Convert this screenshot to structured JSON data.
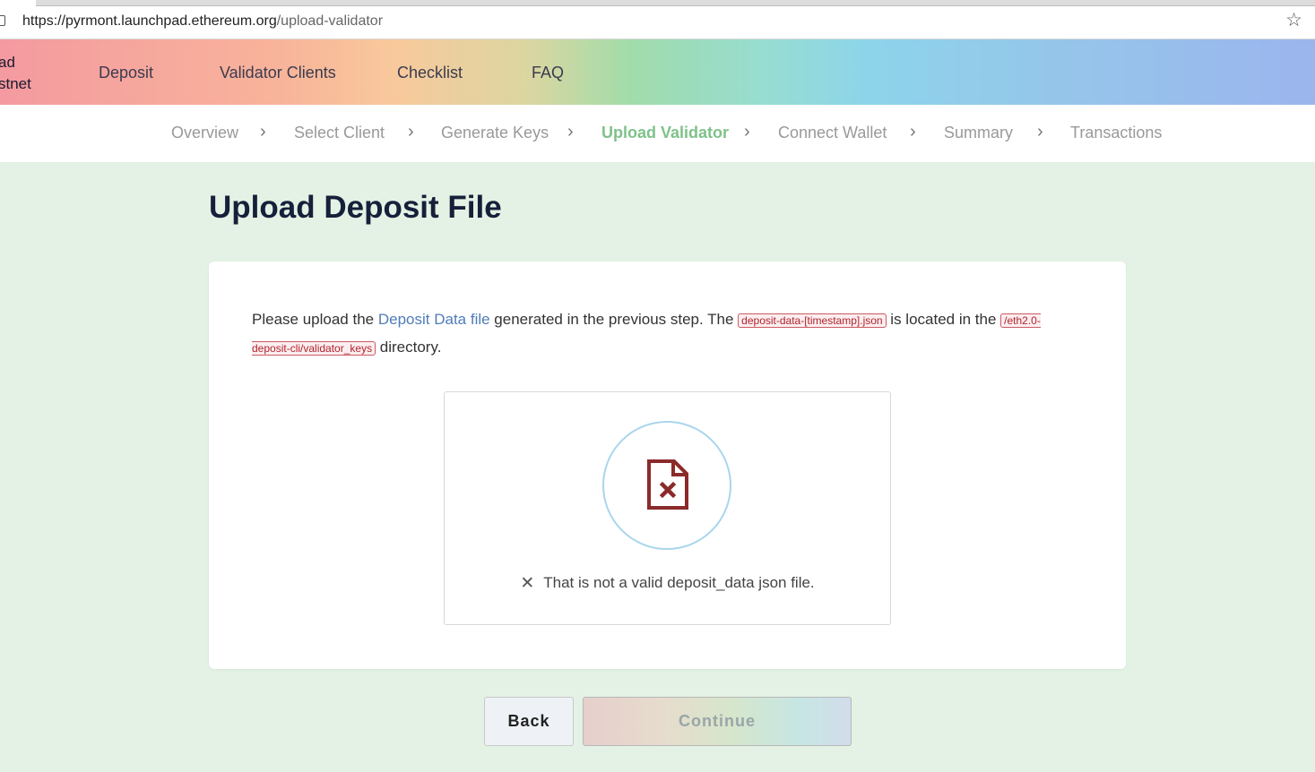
{
  "browser": {
    "url_host": "https://pyrmont.launchpad.ethereum.org",
    "url_path": "/upload-validator"
  },
  "nav": {
    "brand_line1": "ad",
    "brand_line2": "stnet",
    "items": [
      "Deposit",
      "Validator Clients",
      "Checklist",
      "FAQ"
    ]
  },
  "steps": {
    "items": [
      "Overview",
      "Select Client",
      "Generate Keys",
      "Upload Validator",
      "Connect Wallet",
      "Summary",
      "Transactions"
    ],
    "active": "Upload Validator",
    "separator": "›"
  },
  "page": {
    "title": "Upload Deposit File"
  },
  "instructions": {
    "prefix": "Please upload the ",
    "link": "Deposit Data file",
    "mid": " generated in the previous step. The ",
    "code1": "deposit-data-[timestamp].json",
    "mid2": " is located in the ",
    "code2": "/eth2.0-deposit-cli/validator_keys",
    "suffix": " directory."
  },
  "upload": {
    "error_message": "That is not a valid deposit_data json file."
  },
  "buttons": {
    "back": "Back",
    "continue": "Continue"
  },
  "colors": {
    "accent_green": "#7ec28a",
    "error_red": "#8b2a2a",
    "link_blue": "#4f7db8",
    "page_bg": "#e3f2e4"
  },
  "icons": {
    "lock": "lock-icon",
    "bookmark": "star-icon",
    "file_error": "file-x-icon",
    "error": "close-icon",
    "separator": "chevron-right-icon"
  }
}
